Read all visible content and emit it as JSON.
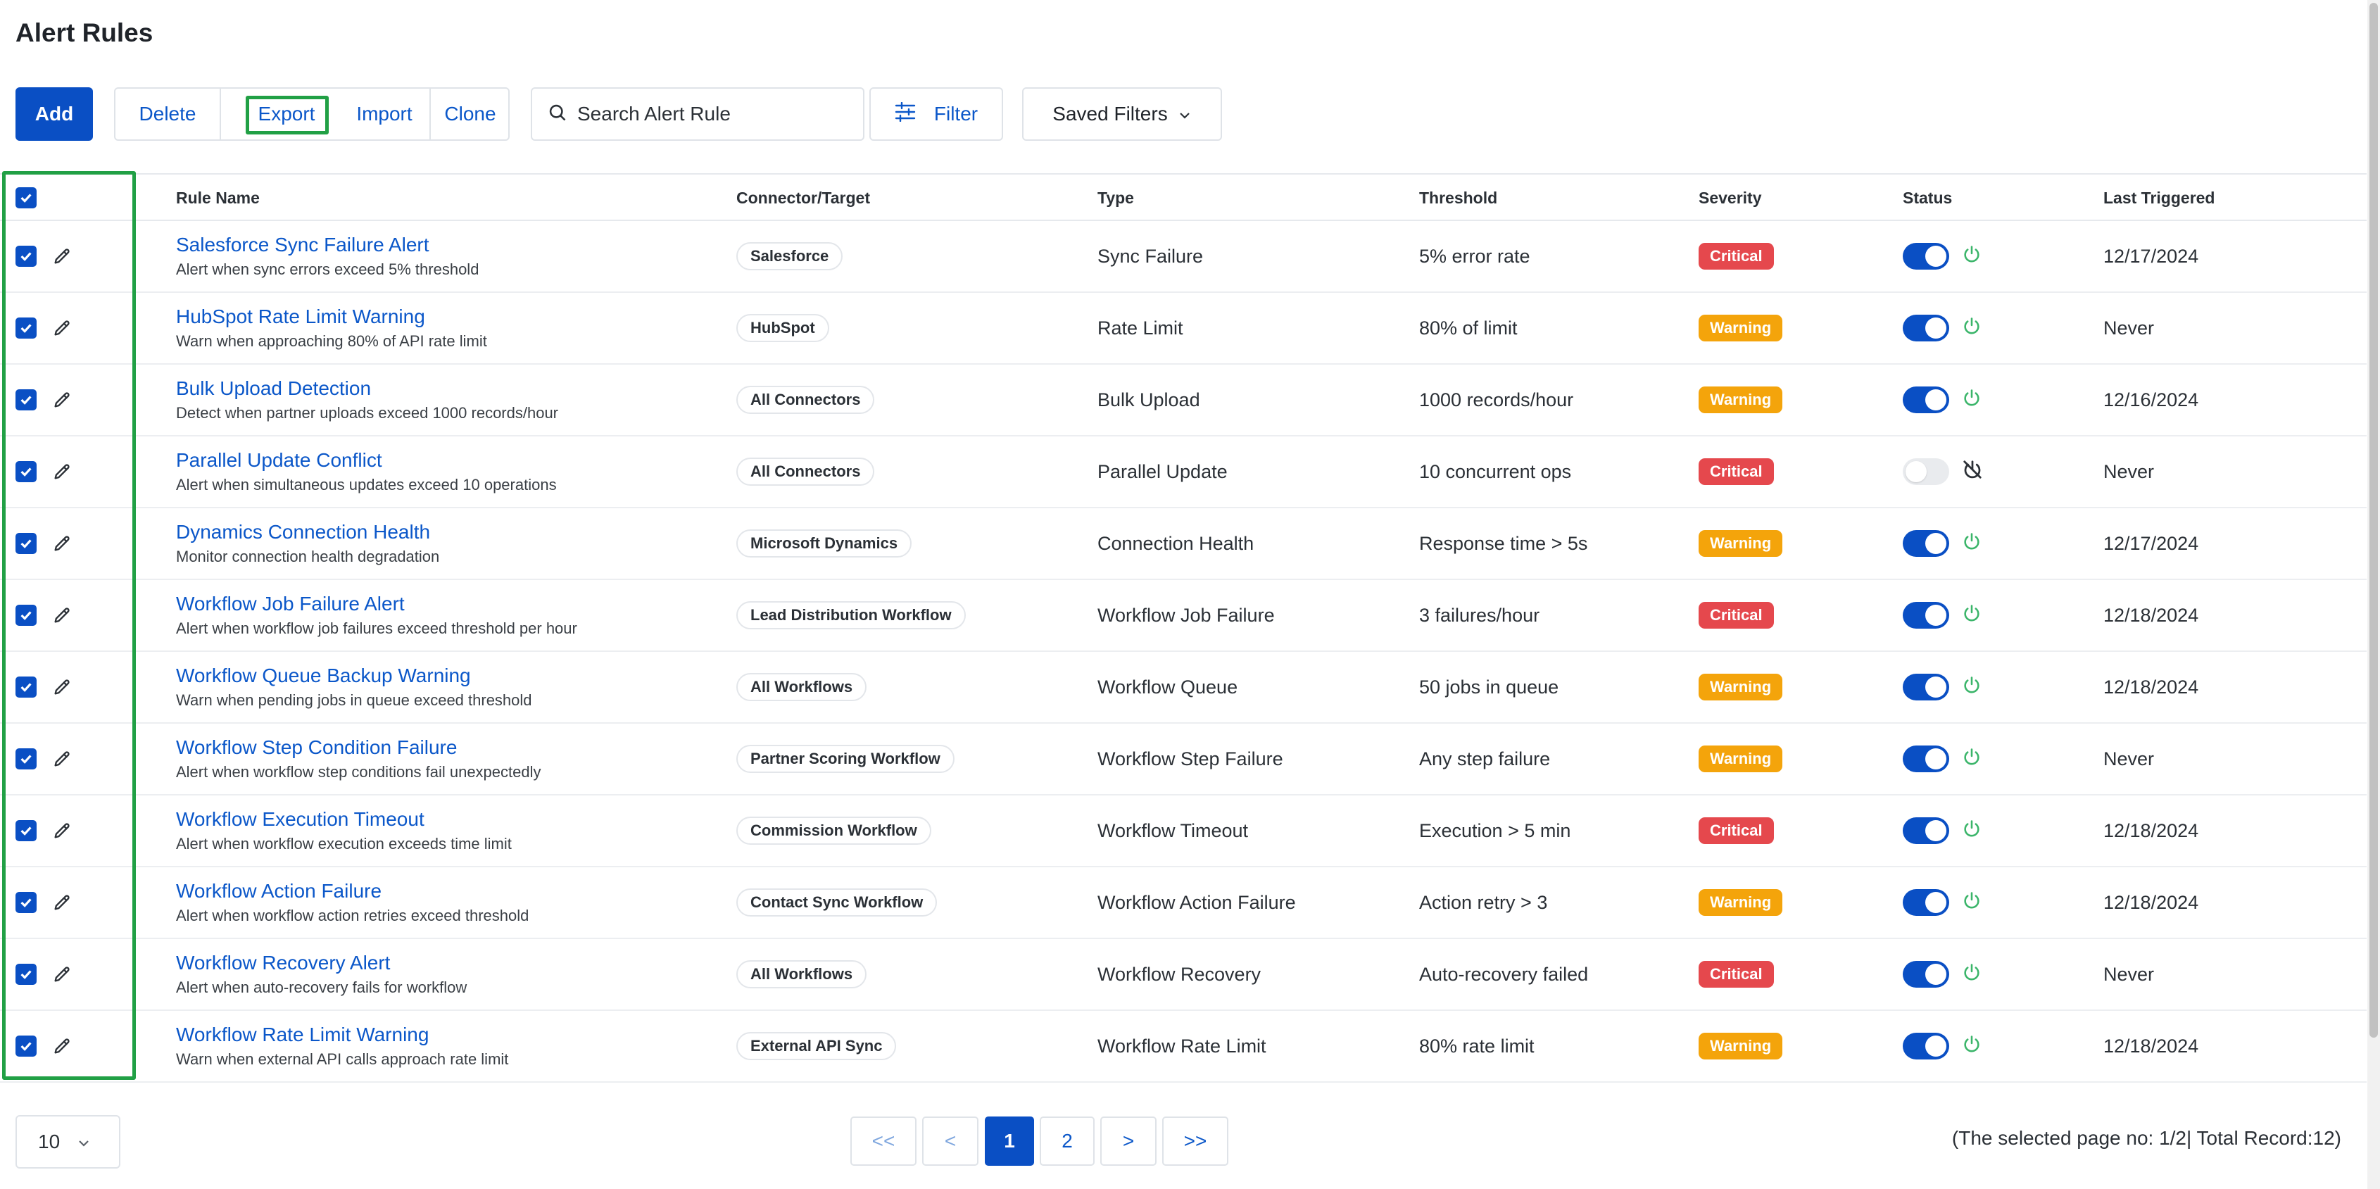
{
  "page": {
    "title": "Alert Rules"
  },
  "toolbar": {
    "add_label": "Add",
    "delete_label": "Delete",
    "export_label": "Export",
    "import_label": "Import",
    "clone_label": "Clone",
    "search_placeholder": "Search Alert Rule",
    "filter_label": "Filter",
    "saved_filters_label": "Saved Filters"
  },
  "table": {
    "columns": {
      "rule_name": "Rule Name",
      "connector": "Connector/Target",
      "type": "Type",
      "threshold": "Threshold",
      "severity": "Severity",
      "status": "Status",
      "last_triggered": "Last Triggered"
    },
    "rows": [
      {
        "name": "Salesforce Sync Failure Alert",
        "desc": "Alert when sync errors exceed 5% threshold",
        "connector": "Salesforce",
        "type": "Sync Failure",
        "threshold": "5% error rate",
        "severity": "Critical",
        "enabled": true,
        "last": "12/17/2024"
      },
      {
        "name": "HubSpot Rate Limit Warning",
        "desc": "Warn when approaching 80% of API rate limit",
        "connector": "HubSpot",
        "type": "Rate Limit",
        "threshold": "80% of limit",
        "severity": "Warning",
        "enabled": true,
        "last": "Never"
      },
      {
        "name": "Bulk Upload Detection",
        "desc": "Detect when partner uploads exceed 1000 records/hour",
        "connector": "All Connectors",
        "type": "Bulk Upload",
        "threshold": "1000 records/hour",
        "severity": "Warning",
        "enabled": true,
        "last": "12/16/2024"
      },
      {
        "name": "Parallel Update Conflict",
        "desc": "Alert when simultaneous updates exceed 10 operations",
        "connector": "All Connectors",
        "type": "Parallel Update",
        "threshold": "10 concurrent ops",
        "severity": "Critical",
        "enabled": false,
        "last": "Never"
      },
      {
        "name": "Dynamics Connection Health",
        "desc": "Monitor connection health degradation",
        "connector": "Microsoft Dynamics",
        "type": "Connection Health",
        "threshold": "Response time > 5s",
        "severity": "Warning",
        "enabled": true,
        "last": "12/17/2024"
      },
      {
        "name": "Workflow Job Failure Alert",
        "desc": "Alert when workflow job failures exceed threshold per hour",
        "connector": "Lead Distribution Workflow",
        "type": "Workflow Job Failure",
        "threshold": "3 failures/hour",
        "severity": "Critical",
        "enabled": true,
        "last": "12/18/2024"
      },
      {
        "name": "Workflow Queue Backup Warning",
        "desc": "Warn when pending jobs in queue exceed threshold",
        "connector": "All Workflows",
        "type": "Workflow Queue",
        "threshold": "50 jobs in queue",
        "severity": "Warning",
        "enabled": true,
        "last": "12/18/2024"
      },
      {
        "name": "Workflow Step Condition Failure",
        "desc": "Alert when workflow step conditions fail unexpectedly",
        "connector": "Partner Scoring Workflow",
        "type": "Workflow Step Failure",
        "threshold": "Any step failure",
        "severity": "Warning",
        "enabled": true,
        "last": "Never"
      },
      {
        "name": "Workflow Execution Timeout",
        "desc": "Alert when workflow execution exceeds time limit",
        "connector": "Commission Workflow",
        "type": "Workflow Timeout",
        "threshold": "Execution > 5 min",
        "severity": "Critical",
        "enabled": true,
        "last": "12/18/2024"
      },
      {
        "name": "Workflow Action Failure",
        "desc": "Alert when workflow action retries exceed threshold",
        "connector": "Contact Sync Workflow",
        "type": "Workflow Action Failure",
        "threshold": "Action retry > 3",
        "severity": "Warning",
        "enabled": true,
        "last": "12/18/2024"
      },
      {
        "name": "Workflow Recovery Alert",
        "desc": "Alert when auto-recovery fails for workflow",
        "connector": "All Workflows",
        "type": "Workflow Recovery",
        "threshold": "Auto-recovery failed",
        "severity": "Critical",
        "enabled": true,
        "last": "Never"
      },
      {
        "name": "Workflow Rate Limit Warning",
        "desc": "Warn when external API calls approach rate limit",
        "connector": "External API Sync",
        "type": "Workflow Rate Limit",
        "threshold": "80% rate limit",
        "severity": "Warning",
        "enabled": true,
        "last": "12/18/2024"
      }
    ]
  },
  "colors": {
    "critical": "#e5484d",
    "warning": "#f4a40b",
    "primary": "#0a4fc4",
    "power_on": "#3bb56a",
    "power_off": "#2b3036"
  },
  "pagination": {
    "page_size": "10",
    "first": "<<",
    "prev": "<",
    "pages": [
      "1",
      "2"
    ],
    "current_page": "1",
    "next": ">",
    "last": ">>",
    "record_info": "(The selected page no: 1/2| Total Record:12)"
  }
}
